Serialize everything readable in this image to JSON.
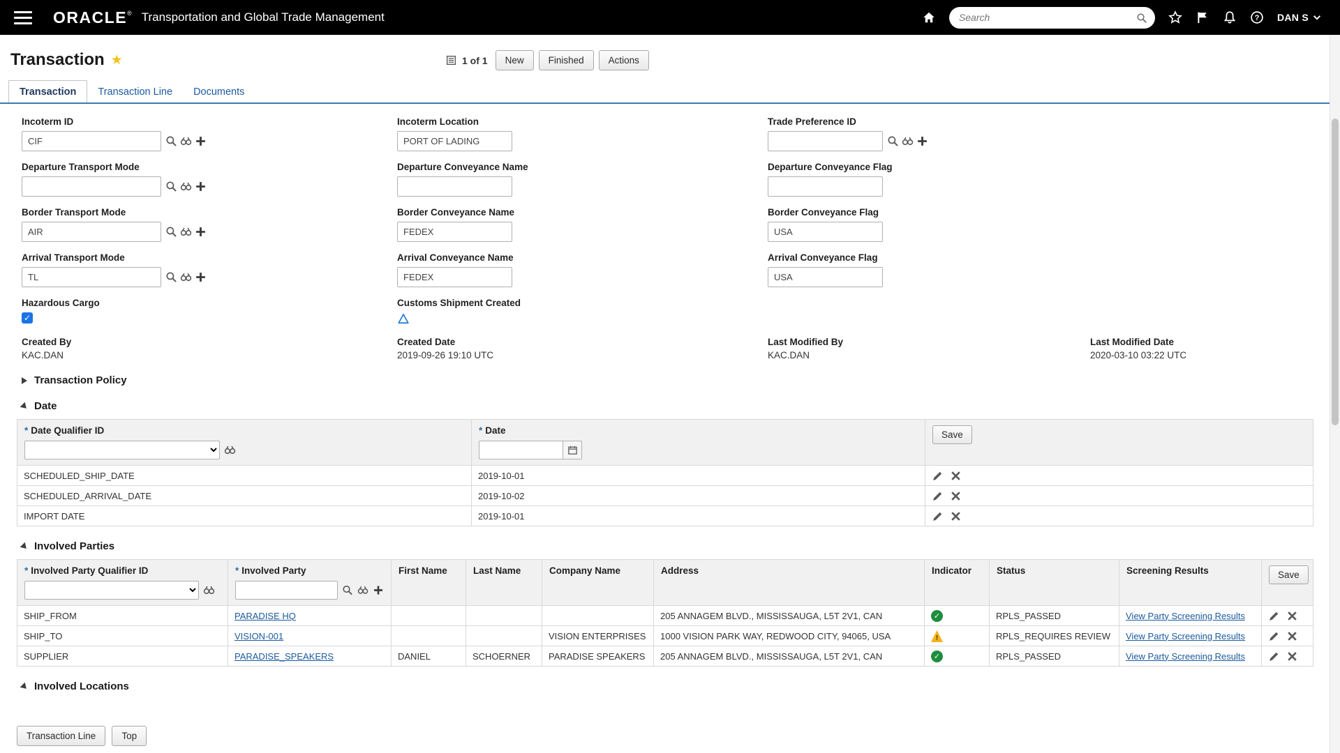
{
  "required_marker": "*",
  "topbar": {
    "brand": "ORACLE",
    "brand_mark": "®",
    "app_title": "Transportation and Global Trade Management",
    "search_placeholder": "Search",
    "user_label": "DAN S"
  },
  "header": {
    "title": "Transaction",
    "record_count": "1 of 1",
    "buttons": {
      "new": "New",
      "finished": "Finished",
      "actions": "Actions"
    }
  },
  "tabs": [
    {
      "label": "Transaction",
      "active": true
    },
    {
      "label": "Transaction Line",
      "active": false
    },
    {
      "label": "Documents",
      "active": false
    }
  ],
  "form": {
    "incoterm_id": {
      "label": "Incoterm ID",
      "value": "CIF"
    },
    "incoterm_location": {
      "label": "Incoterm Location",
      "value": "PORT OF LADING"
    },
    "trade_preference_id": {
      "label": "Trade Preference ID",
      "value": ""
    },
    "departure_transport_mode": {
      "label": "Departure Transport Mode",
      "value": ""
    },
    "departure_conveyance_name": {
      "label": "Departure Conveyance Name",
      "value": ""
    },
    "departure_conveyance_flag": {
      "label": "Departure Conveyance Flag",
      "value": ""
    },
    "border_transport_mode": {
      "label": "Border Transport Mode",
      "value": "AIR"
    },
    "border_conveyance_name": {
      "label": "Border Conveyance Name",
      "value": "FEDEX"
    },
    "border_conveyance_flag": {
      "label": "Border Conveyance Flag",
      "value": "USA"
    },
    "arrival_transport_mode": {
      "label": "Arrival Transport Mode",
      "value": "TL"
    },
    "arrival_conveyance_name": {
      "label": "Arrival Conveyance Name",
      "value": "FEDEX"
    },
    "arrival_conveyance_flag": {
      "label": "Arrival Conveyance Flag",
      "value": "USA"
    },
    "hazardous_cargo_label": "Hazardous Cargo",
    "hazardous_cargo_checked": true,
    "customs_shipment_created_label": "Customs Shipment Created",
    "created_by": {
      "label": "Created By",
      "value": "KAC.DAN"
    },
    "created_date": {
      "label": "Created Date",
      "value": "2019-09-26 19:10 UTC"
    },
    "last_modified_by": {
      "label": "Last Modified By",
      "value": "KAC.DAN"
    },
    "last_modified_date": {
      "label": "Last Modified Date",
      "value": "2020-03-10 03:22 UTC"
    }
  },
  "sections": {
    "transaction_policy": "Transaction Policy",
    "date": "Date",
    "involved_parties": "Involved Parties",
    "involved_locations": "Involved Locations"
  },
  "date_table": {
    "headers": {
      "qualifier": "Date Qualifier ID",
      "date": "Date"
    },
    "save_label": "Save",
    "rows": [
      {
        "qualifier": "SCHEDULED_SHIP_DATE",
        "date": "2019-10-01"
      },
      {
        "qualifier": "SCHEDULED_ARRIVAL_DATE",
        "date": "2019-10-02"
      },
      {
        "qualifier": "IMPORT DATE",
        "date": "2019-10-01"
      }
    ]
  },
  "parties_table": {
    "headers": {
      "qualifier": "Involved Party Qualifier ID",
      "party": "Involved Party",
      "first_name": "First Name",
      "last_name": "Last Name",
      "company_name": "Company Name",
      "address": "Address",
      "indicator": "Indicator",
      "status": "Status",
      "screening": "Screening Results"
    },
    "save_label": "Save",
    "rows": [
      {
        "qualifier": "SHIP_FROM",
        "party": "PARADISE HQ",
        "first_name": "",
        "last_name": "",
        "company_name": "",
        "address": "205 ANNAGEM BLVD., MISSISSAUGA, L5T 2V1, CAN",
        "indicator": "ok",
        "status": "RPLS_PASSED",
        "screening": "View Party Screening Results"
      },
      {
        "qualifier": "SHIP_TO",
        "party": "VISION-001",
        "first_name": "",
        "last_name": "",
        "company_name": "VISION ENTERPRISES",
        "address": "1000 VISION PARK WAY, REDWOOD CITY, 94065, USA",
        "indicator": "warning",
        "status": "RPLS_REQUIRES REVIEW",
        "screening": "View Party Screening Results"
      },
      {
        "qualifier": "SUPPLIER",
        "party": "PARADISE_SPEAKERS",
        "first_name": "DANIEL",
        "last_name": "SCHOERNER",
        "company_name": "PARADISE SPEAKERS",
        "address": "205 ANNAGEM BLVD., MISSISSAUGA, L5T 2V1, CAN",
        "indicator": "ok",
        "status": "RPLS_PASSED",
        "screening": "View Party Screening Results"
      }
    ]
  },
  "footer": {
    "transaction_line": "Transaction Line",
    "top": "Top"
  },
  "colors": {
    "topbar_bg": "#000000",
    "tab_accent_blue": "#4076b4",
    "link_blue": "#1a5a9e",
    "star_gold": "#f2c21a",
    "ok_green": "#1e8e3e",
    "warning_yellow": "#f6b21b",
    "required_asterisk": "#2e6da4",
    "checkbox_blue": "#1a73e8"
  },
  "icons": {
    "topbar": [
      "menu-icon",
      "home-icon",
      "search-icon",
      "favorites-star-icon",
      "flag-icon",
      "notifications-bell-icon",
      "help-icon",
      "chevron-down-icon"
    ],
    "field_lookup": [
      "search-lookup-icon",
      "binoculars-icon",
      "add-plus-icon"
    ],
    "row_actions": [
      "edit-pencil-icon",
      "delete-x-icon"
    ],
    "indicator_ok": "green-check-circle-icon",
    "indicator_warning": "yellow-warning-triangle-icon",
    "customs_shipment": "blue-triangle-outline-icon",
    "date_picker": "calendar-icon",
    "record_count": "record-list-icon"
  }
}
